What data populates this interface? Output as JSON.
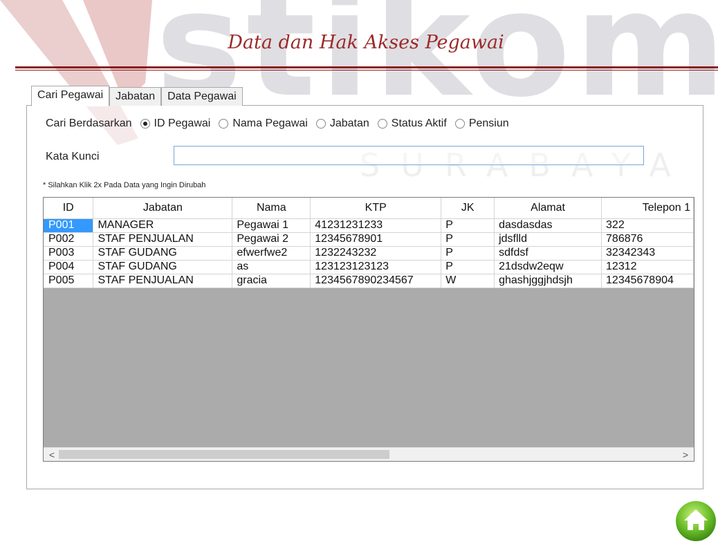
{
  "watermark": {
    "main": "stikom",
    "sub": "SURABAYA"
  },
  "title": "Data dan Hak Akses Pegawai",
  "tabs": [
    {
      "label": "Cari Pegawai",
      "active": true
    },
    {
      "label": "Jabatan",
      "active": false
    },
    {
      "label": "Data Pegawai",
      "active": false
    }
  ],
  "filter": {
    "label": "Cari Berdasarkan",
    "options": [
      {
        "label": "ID Pegawai",
        "checked": true
      },
      {
        "label": "Nama Pegawai",
        "checked": false
      },
      {
        "label": "Jabatan",
        "checked": false
      },
      {
        "label": "Status Aktif",
        "checked": false
      },
      {
        "label": "Pensiun",
        "checked": false
      }
    ]
  },
  "search": {
    "label": "Kata Kunci",
    "value": ""
  },
  "hint": "* Silahkan Klik 2x Pada Data yang Ingin Dirubah",
  "table": {
    "headers": [
      "ID",
      "Jabatan",
      "Nama",
      "KTP",
      "JK",
      "Alamat",
      "Telepon 1"
    ],
    "rows": [
      [
        "P001",
        "MANAGER",
        "Pegawai 1",
        "41231231233",
        "P",
        "dasdasdas",
        "322"
      ],
      [
        "P002",
        "STAF PENJUALAN",
        "Pegawai 2",
        "12345678901",
        "P",
        "jdsflld",
        "786876"
      ],
      [
        "P003",
        "STAF GUDANG",
        "efwerfwe2",
        "1232243232",
        "P",
        "sdfdsf",
        "32342343"
      ],
      [
        "P004",
        "STAF GUDANG",
        "as",
        "123123123123",
        "P",
        "21dsdw2eqw",
        "12312"
      ],
      [
        "P005",
        "STAF PENJUALAN",
        "gracia",
        "1234567890234567",
        "W",
        "ghashjggjhdsjh",
        "12345678904"
      ]
    ],
    "selected_row": 0
  },
  "scroll": {
    "left_arrow": "<",
    "right_arrow": ">"
  },
  "colors": {
    "title": "#9c2a2a",
    "rule": "#8b1a1a",
    "selection": "#3399ff",
    "grid_empty": "#ababab"
  },
  "icons": {
    "home": "home-icon"
  }
}
